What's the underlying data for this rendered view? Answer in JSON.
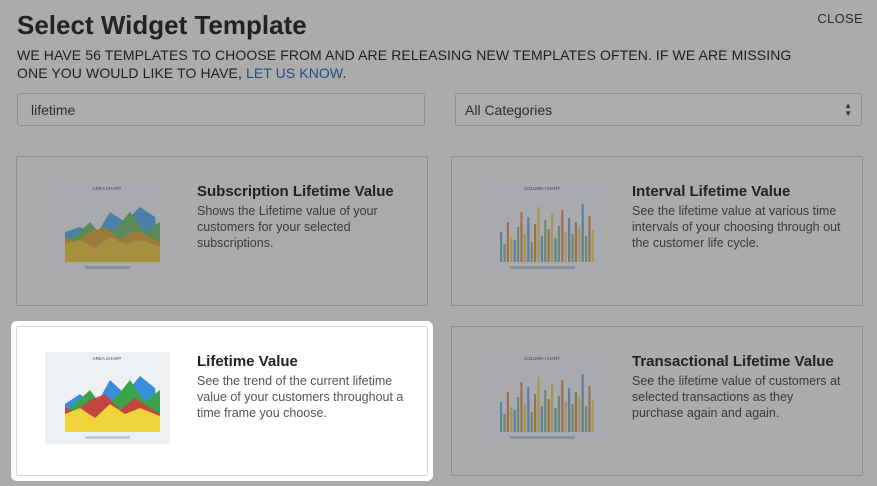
{
  "header": {
    "title": "Select Widget Template",
    "close_label": "CLOSE",
    "description_text": "WE HAVE 56 TEMPLATES TO CHOOSE FROM AND ARE RELEASING NEW TEMPLATES OFTEN. IF WE ARE MISSING ONE YOU WOULD LIKE TO HAVE, ",
    "description_link": "LET US KNOW",
    "description_end": "."
  },
  "filters": {
    "search_value": "lifetime",
    "category_selected": "All Categories"
  },
  "cards": [
    {
      "title": "Subscription Lifetime Value",
      "description": "Shows the Lifetime value of your customers for your selected subscriptions.",
      "thumbnail": "area-chart-thumbnail",
      "thumb_title": "AREA CHART",
      "selected": false
    },
    {
      "title": "Interval Lifetime Value",
      "description": "See the lifetime value at various time intervals of your choosing through out the customer life cycle.",
      "thumbnail": "column-chart-thumbnail",
      "thumb_title": "COLUMN CHART",
      "selected": false
    },
    {
      "title": "Lifetime Value",
      "description": "See the trend of the current lifetime value of your customers throughout a time frame you choose.",
      "thumbnail": "area-chart-thumbnail",
      "thumb_title": "AREA CHART",
      "selected": true
    },
    {
      "title": "Transactional Lifetime Value",
      "description": "See the lifetime value of customers at selected transactions as they purchase again and again.",
      "thumbnail": "column-chart-thumbnail",
      "thumb_title": "COLUMN CHART",
      "selected": false
    }
  ],
  "colors": {
    "overlay": "#ababab",
    "link": "#1f4f86",
    "series_blue": "#3b8fd8",
    "series_green": "#3aa24a",
    "series_red": "#d23b3b",
    "series_yellow": "#f0d23a"
  }
}
